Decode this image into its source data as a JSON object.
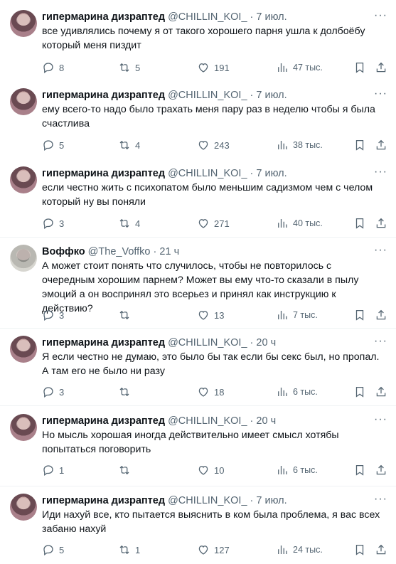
{
  "tweets": [
    {
      "author_name": "гипермарина дизраптед",
      "handle": "@CHILLIN_KOI_",
      "time": "7 июл.",
      "text": "все удивлялись почему я от такого хорошего парня ушла к долбоёбу который меня пиздит",
      "replies": "8",
      "retweets": "5",
      "likes": "191",
      "views": "47 тыс."
    },
    {
      "author_name": "гипермарина дизраптед",
      "handle": "@CHILLIN_KOI_",
      "time": "7 июл.",
      "text": "ему всего-то надо было трахать меня пару раз в неделю чтобы я была счастлива",
      "replies": "5",
      "retweets": "4",
      "likes": "243",
      "views": "38 тыс."
    },
    {
      "author_name": "гипермарина дизраптед",
      "handle": "@CHILLIN_KOI_",
      "time": "7 июл.",
      "text": "если честно жить с психопатом было меньшим садизмом чем с челом который ну вы поняли",
      "replies": "3",
      "retweets": "4",
      "likes": "271",
      "views": "40 тыс."
    },
    {
      "author_name": "Воффко",
      "handle": "@The_Voffko",
      "time": "21 ч",
      "text": "А может стоит понять что случилось, чтобы не повторилось с очередным хорошим парнем? Может вы ему что-то сказали в пылу эмоций а он воспринял это всерьез и принял как инструкцию к действию?",
      "replies": "3",
      "retweets": "",
      "likes": "13",
      "views": "7 тыс."
    },
    {
      "author_name": "гипермарина дизраптед",
      "handle": "@CHILLIN_KOI_",
      "time": "20 ч",
      "text": "Я если честно не думаю, это было бы так если бы секс был, но пропал. А там его не было ни разу",
      "replies": "3",
      "retweets": "",
      "likes": "18",
      "views": "6 тыс."
    },
    {
      "author_name": "гипермарина дизраптед",
      "handle": "@CHILLIN_KOI_",
      "time": "20 ч",
      "text": "Но мысль хорошая иногда действительно имеет смысл хотябы попытаться поговорить",
      "replies": "1",
      "retweets": "",
      "likes": "10",
      "views": "6 тыс."
    },
    {
      "author_name": "гипермарина дизраптед",
      "handle": "@CHILLIN_KOI_",
      "time": "7 июл.",
      "text": "Иди нахуй все, кто пытается выяснить в ком была проблема, я вас всех забаню нахуй",
      "replies": "5",
      "retweets": "1",
      "likes": "127",
      "views": "24 тыс."
    }
  ],
  "separator": "·",
  "more_glyph": "···",
  "icons": {
    "reply": "reply-icon",
    "retweet": "retweet-icon",
    "like": "heart-icon",
    "views": "views-bar-chart-icon",
    "bookmark": "bookmark-icon",
    "share": "share-icon",
    "avatar": "avatar"
  },
  "colors": {
    "text": "#0f1419",
    "muted": "#536471",
    "divider": "#eff3f4",
    "background": "#ffffff"
  }
}
